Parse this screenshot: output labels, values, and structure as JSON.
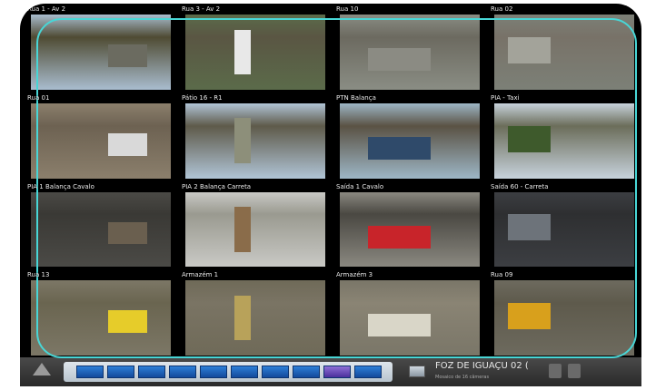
{
  "cameras": [
    {
      "label": "Rua 1 - Av 2",
      "scene": {
        "sky": "#a9bdcf",
        "ground": "#4f4b33",
        "object": "#6b6b60"
      }
    },
    {
      "label": "Rua 3 - Av 2",
      "scene": {
        "sky": "#5b6b4a",
        "ground": "#5a5643",
        "object": "#e8e8e8"
      }
    },
    {
      "label": "Rua 10",
      "scene": {
        "sky": "#8a8d84",
        "ground": "#6c6a60",
        "object": "#8b8b83"
      }
    },
    {
      "label": "Rua 02",
      "scene": {
        "sky": "#7c8077",
        "ground": "#787268",
        "object": "#a3a39a"
      }
    },
    {
      "label": "Rua 01",
      "scene": {
        "sky": "#8b7f6c",
        "ground": "#6d6252",
        "object": "#d9d9d9"
      }
    },
    {
      "label": "Pátio 16 - R1",
      "scene": {
        "sky": "#b0c4d6",
        "ground": "#5e5a4a",
        "object": "#8d8f7a"
      }
    },
    {
      "label": "PTN Balança",
      "scene": {
        "sky": "#9db6c6",
        "ground": "#5a5244",
        "object": "#2f4a6a"
      }
    },
    {
      "label": "PIA - Taxi",
      "scene": {
        "sky": "#c7d2dc",
        "ground": "#6b6d5a",
        "object": "#3e5a2c"
      }
    },
    {
      "label": "PIA 1 Balança Cavalo",
      "scene": {
        "sky": "#4b4a46",
        "ground": "#3a3935",
        "object": "#6a5f4f"
      }
    },
    {
      "label": "PIA 2 Balança Carreta",
      "scene": {
        "sky": "#c9c9c5",
        "ground": "#9a9a90",
        "object": "#8a6c4a"
      }
    },
    {
      "label": "Saída 1 Cavalo",
      "scene": {
        "sky": "#8a8880",
        "ground": "#4a4842",
        "object": "#c8242a"
      }
    },
    {
      "label": "Saída 60 - Carreta",
      "scene": {
        "sky": "#3c3e42",
        "ground": "#2e2f31",
        "object": "#6d737a"
      }
    },
    {
      "label": "Rua 13",
      "scene": {
        "sky": "#7c7766",
        "ground": "#6a6550",
        "object": "#e6cc2a"
      }
    },
    {
      "label": "Armazém 1",
      "scene": {
        "sky": "#6f6a58",
        "ground": "#7a7464",
        "object": "#b8a25a"
      }
    },
    {
      "label": "Armazém 3",
      "scene": {
        "sky": "#7a7668",
        "ground": "#8a8474",
        "object": "#d9d6c8"
      }
    },
    {
      "label": "Rua 09",
      "scene": {
        "sky": "#6d6a5e",
        "ground": "#5e5a4c",
        "object": "#d8a01c"
      }
    }
  ],
  "bottom_bar": {
    "server_name": "FOZ DE IGUAÇU 02 (",
    "server_sub": "Mosaico de 16 câmeras",
    "layout_buttons": 10,
    "active_layout_index": 8
  },
  "colors": {
    "selection_outline": "#48d6d6",
    "layout_button": "#2d7fd8"
  }
}
